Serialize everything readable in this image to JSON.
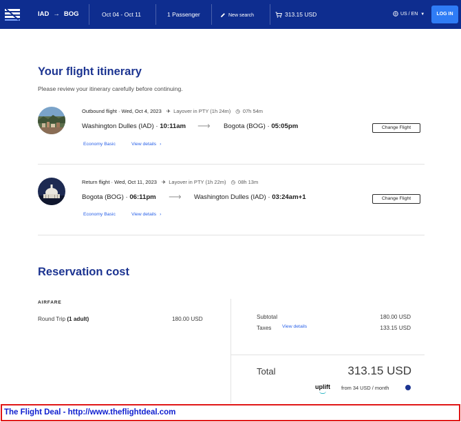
{
  "header": {
    "origin": "IAD",
    "destination": "BOG",
    "dates": "Oct 04 - Oct 11",
    "passengers": "1 Passenger",
    "new_search": "New search",
    "cart_total": "313.15 USD",
    "locale": "US / EN",
    "login": "LOG IN"
  },
  "itinerary": {
    "title": "Your flight itinerary",
    "subtitle": "Please review your itinerary carefully before continuing.",
    "flights": [
      {
        "label": "Outbound flight · Wed, Oct 4, 2023",
        "layover": "Layover in PTY (1h 24m)",
        "duration": "07h 54m",
        "from": "Washington Dulles (IAD) · ",
        "from_time": "10:11am",
        "to": "Bogota (BOG) · ",
        "to_time": "05:05pm",
        "fare": "Economy Basic",
        "details": "View details",
        "change": "Change Flight"
      },
      {
        "label": "Return flight · Wed, Oct 11, 2023",
        "layover": "Layover in PTY (1h 22m)",
        "duration": "08h 13m",
        "from": "Bogota (BOG) · ",
        "from_time": "06:11pm",
        "to": "Washington Dulles (IAD) · ",
        "to_time": "03:24am+1",
        "fare": "Economy Basic",
        "details": "View details",
        "change": "Change Flight"
      }
    ]
  },
  "cost": {
    "title": "Reservation cost",
    "airfare_label": "AIRFARE",
    "trip_label": "Round Trip ",
    "trip_adults": "(1 adult)",
    "trip_amount": "180.00 USD",
    "subtotal_label": "Subtotal",
    "subtotal_amount": "180.00 USD",
    "taxes_label": "Taxes",
    "taxes_link": "View details",
    "taxes_amount": "133.15 USD",
    "total_label": "Total",
    "total_amount": "313.15 USD",
    "uplift_brand": "uplift",
    "uplift_text": "from 34 USD  / month"
  },
  "watermark": "The Flight Deal - http://www.theflightdeal.com",
  "colors": {
    "header_bg": "#0e2d8f",
    "title": "#1c3491",
    "link": "#2860e8",
    "login_bg": "#2f7cf6",
    "banner_border": "#e01515",
    "banner_text": "#1020d0"
  },
  "icons": [
    "logo-icon",
    "arrow-right-icon",
    "pencil-icon",
    "cart-icon",
    "globe-icon",
    "chevron-down-icon",
    "plane-icon",
    "clock-icon",
    "chevron-right-icon",
    "info-icon"
  ]
}
